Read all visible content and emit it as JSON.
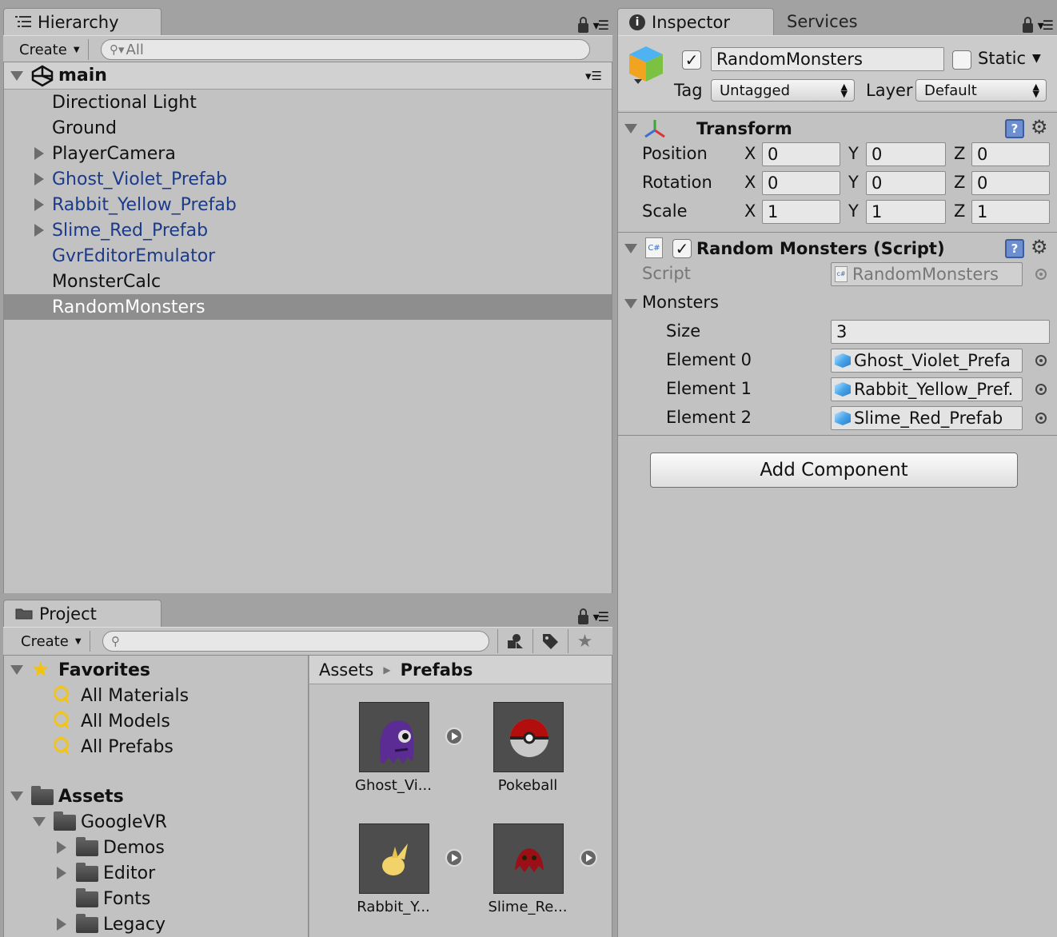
{
  "hierarchy": {
    "tab_label": "Hierarchy",
    "create_label": "Create",
    "search_placeholder": "All",
    "scene_name": "main",
    "items": [
      {
        "label": "Directional Light"
      },
      {
        "label": "Ground"
      },
      {
        "label": "PlayerCamera"
      },
      {
        "label": "Ghost_Violet_Prefab"
      },
      {
        "label": "Rabbit_Yellow_Prefab"
      },
      {
        "label": "Slime_Red_Prefab"
      },
      {
        "label": "GvrEditorEmulator"
      },
      {
        "label": "MonsterCalc"
      },
      {
        "label": "RandomMonsters"
      }
    ],
    "prefab_color": "#1b3a8a",
    "selected_color": "#8e8e8e"
  },
  "inspector": {
    "tab_label": "Inspector",
    "services_tab_label": "Services",
    "object_name": "RandomMonsters",
    "static_label": "Static",
    "tag_label": "Tag",
    "tag_value": "Untagged",
    "layer_label": "Layer",
    "layer_value": "Default",
    "transform": {
      "title": "Transform",
      "rows": [
        {
          "label": "Position",
          "x": "0",
          "y": "0",
          "z": "0"
        },
        {
          "label": "Rotation",
          "x": "0",
          "y": "0",
          "z": "0"
        },
        {
          "label": "Scale",
          "x": "1",
          "y": "1",
          "z": "1"
        }
      ],
      "axis_x": "X",
      "axis_y": "Y",
      "axis_z": "Z"
    },
    "script_component": {
      "title": "Random Monsters (Script)",
      "script_label": "Script",
      "script_value": "RandomMonsters",
      "monsters_label": "Monsters",
      "size_label": "Size",
      "size_value": "3",
      "elements": [
        {
          "label": "Element 0",
          "value": "Ghost_Violet_Prefa"
        },
        {
          "label": "Element 1",
          "value": "Rabbit_Yellow_Pref."
        },
        {
          "label": "Element 2",
          "value": "Slime_Red_Prefab"
        }
      ]
    },
    "add_component_label": "Add Component"
  },
  "project": {
    "tab_label": "Project",
    "create_label": "Create",
    "favorites": {
      "label": "Favorites",
      "items": [
        "All Materials",
        "All Models",
        "All Prefabs"
      ]
    },
    "assets": {
      "label": "Assets",
      "googlevr": "GoogleVR",
      "children": [
        "Demos",
        "Editor",
        "Fonts",
        "Legacy"
      ]
    },
    "breadcrumb": {
      "root": "Assets",
      "current": "Prefabs"
    },
    "grid": [
      {
        "label": "Ghost_Vi..."
      },
      {
        "label": "Pokeball"
      },
      {
        "label": "Rabbit_Y..."
      },
      {
        "label": "Slime_Re..."
      }
    ]
  }
}
